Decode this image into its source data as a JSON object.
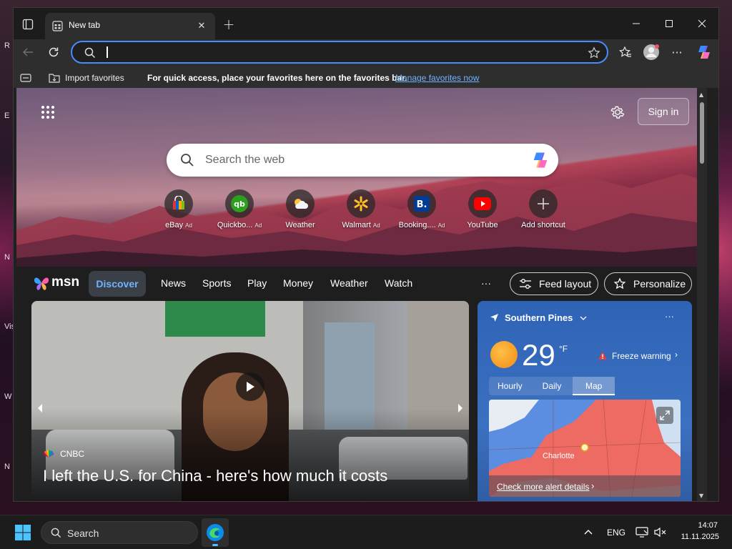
{
  "desktop": {
    "labels": [
      "R",
      "E",
      "N",
      "Vis",
      "W",
      "N"
    ]
  },
  "browser": {
    "tab": {
      "title": "New tab"
    },
    "toolbar": {
      "address_value": ""
    },
    "favorites_bar": {
      "import_label": "Import favorites",
      "hint": "For quick access, place your favorites here on the favorites bar.",
      "manage_link": "Manage favorites now"
    }
  },
  "newtab": {
    "signin_label": "Sign in",
    "search_placeholder": "Search the web",
    "ad_label": "Ad",
    "shortcuts": [
      {
        "label": "eBay",
        "ad": true,
        "icon": "ebay-icon"
      },
      {
        "label": "Quickbo...",
        "ad": true,
        "icon": "quickbooks-icon"
      },
      {
        "label": "Weather",
        "ad": false,
        "icon": "weather-icon"
      },
      {
        "label": "Walmart",
        "ad": true,
        "icon": "walmart-icon"
      },
      {
        "label": "Booking....",
        "ad": true,
        "icon": "booking-icon"
      },
      {
        "label": "YouTube",
        "ad": false,
        "icon": "youtube-icon"
      },
      {
        "label": "Add shortcut",
        "ad": false,
        "icon": "plus-icon"
      }
    ]
  },
  "msn": {
    "logo": "msn",
    "nav": [
      "Discover",
      "News",
      "Sports",
      "Play",
      "Money",
      "Weather",
      "Watch"
    ],
    "more": "···",
    "feed_layout": "Feed layout",
    "personalize": "Personalize"
  },
  "news": {
    "source": "CNBC",
    "headline": "I left the U.S. for China - here's how much it costs"
  },
  "weather": {
    "location": "Southern Pines",
    "temp": "29",
    "unit": "°F",
    "alert": "Freeze warning",
    "tabs": [
      "Hourly",
      "Daily",
      "Map"
    ],
    "active_tab": "Map",
    "map_city": "Charlotte",
    "alert_link": "Check more alert details",
    "more": "···"
  },
  "taskbar": {
    "search_label": "Search",
    "language": "ENG",
    "time": "14:07",
    "date": "11.11.2025"
  },
  "colors": {
    "accent": "#4a8cff",
    "link": "#6fb4ff",
    "youtube": "#ff0000",
    "alert": "#e0403a"
  }
}
